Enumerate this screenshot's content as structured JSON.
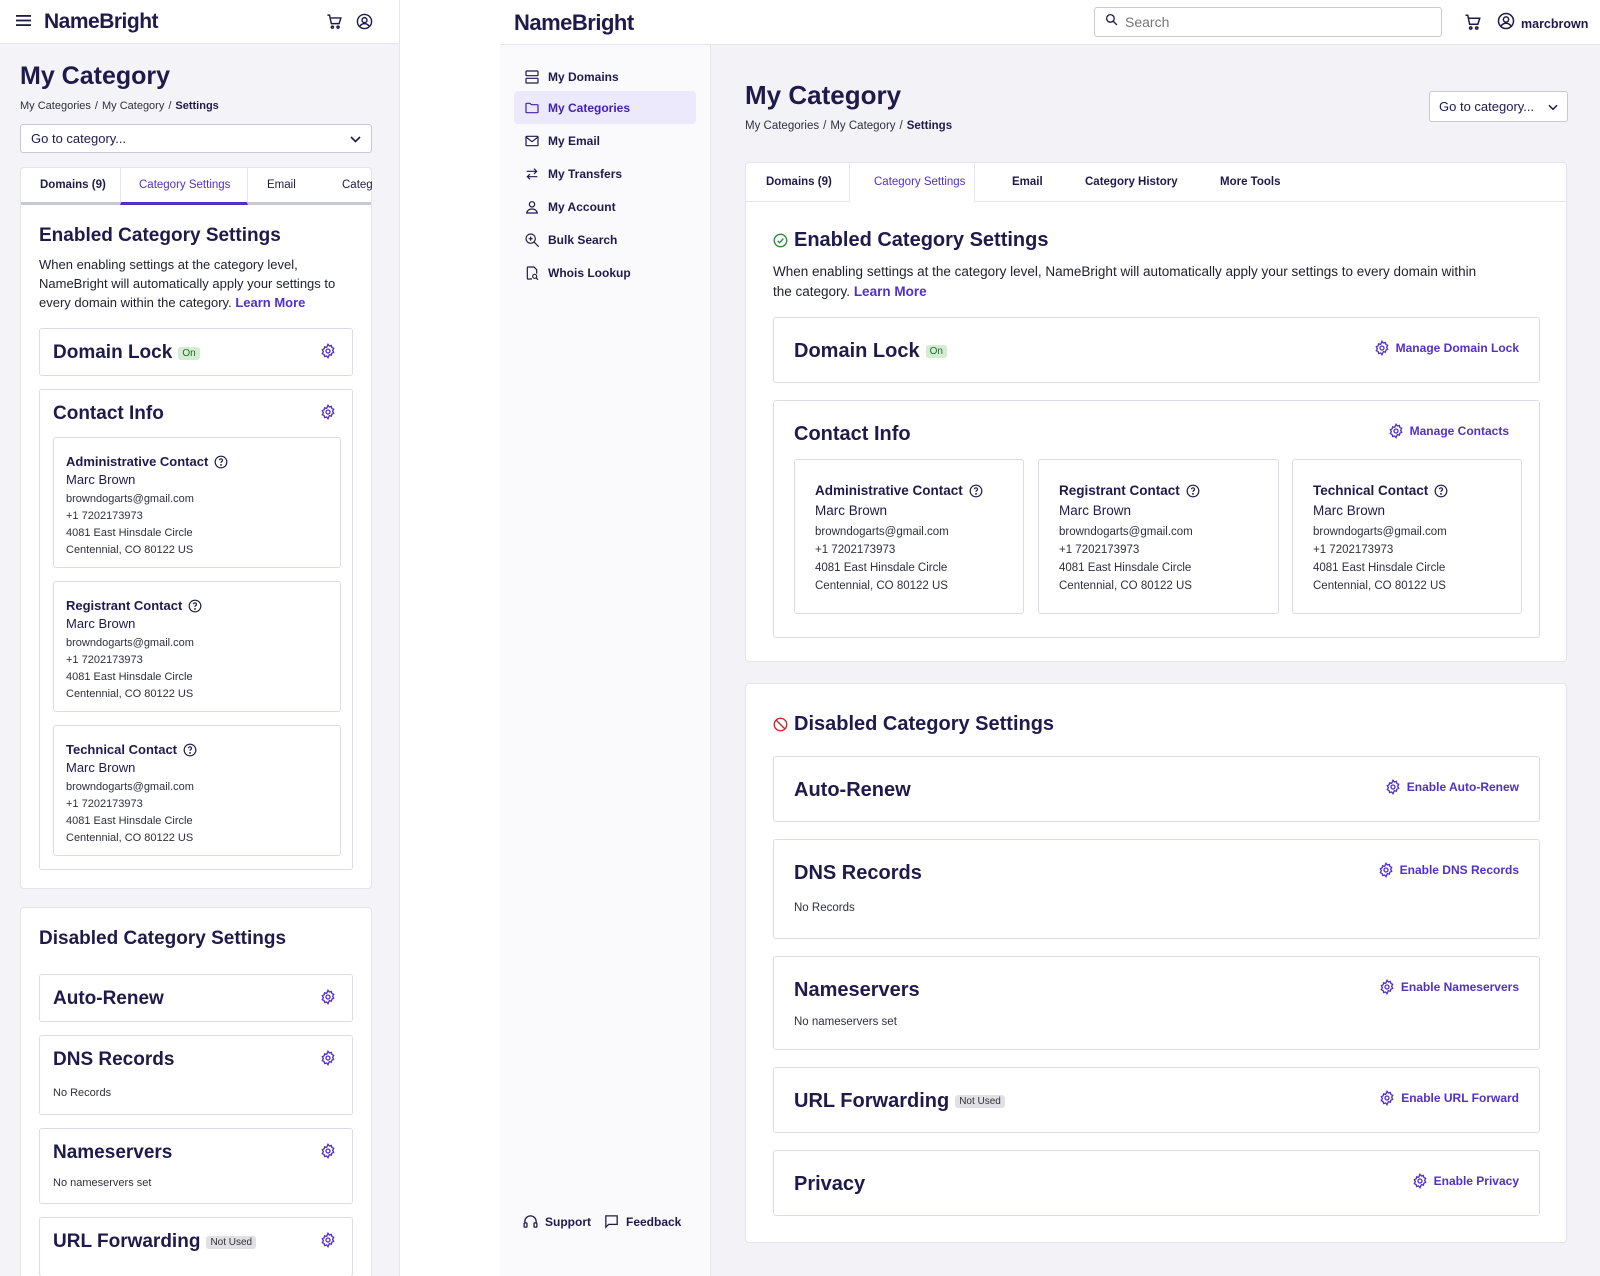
{
  "brand": "NameBright",
  "colors": {
    "accent": "#5230c7",
    "navy": "#1e1b4b",
    "on_badge": "#d4ecd3",
    "not_used_badge": "#e0e0e6",
    "check_green": "#2e8a3a",
    "disabled_red": "#c62828"
  },
  "header": {
    "search_placeholder": "Search",
    "username": "marcbrown"
  },
  "sidebar": {
    "items": [
      {
        "label": "My Domains",
        "icon": "server-icon"
      },
      {
        "label": "My Categories",
        "icon": "folder-icon"
      },
      {
        "label": "My Email",
        "icon": "mail-icon"
      },
      {
        "label": "My Transfers",
        "icon": "transfer-icon"
      },
      {
        "label": "My Account",
        "icon": "user-icon"
      },
      {
        "label": "Bulk Search",
        "icon": "search-plus-icon"
      },
      {
        "label": "Whois Lookup",
        "icon": "whois-icon"
      }
    ],
    "active_index": 1,
    "support": "Support",
    "feedback": "Feedback"
  },
  "page": {
    "title": "My Category",
    "breadcrumb": {
      "first": "My Categories",
      "second": "My Category",
      "current": "Settings",
      "sep": "/"
    },
    "go_to_category": "Go to category..."
  },
  "tabs": [
    "Domains (9)",
    "Category Settings",
    "Email",
    "Category History",
    "More Tools"
  ],
  "tabs_mobile_truncated": "Categ",
  "active_tab": 1,
  "enabled": {
    "title": "Enabled Category Settings",
    "desc": "When enabling settings at the category level, NameBright will automatically apply your settings to every domain within the category.",
    "desc_mobile_lines": [
      "When enabling settings at the category level,",
      "NameBright will automatically apply your settings to",
      "every domain within the category."
    ],
    "desc_line1": "When enabling settings at the category level, NameBright will automatically apply your settings to every domain within",
    "desc_line2": "the category.",
    "learn_more": "Learn More",
    "domain_lock": {
      "title": "Domain Lock",
      "badge": "On",
      "action": "Manage Domain Lock"
    },
    "contact_info": {
      "title": "Contact Info",
      "action": "Manage Contacts"
    },
    "contacts": [
      {
        "type": "Administrative Contact",
        "name": "Marc Brown",
        "email": "browndogarts@gmail.com",
        "phone": "+1 7202173973",
        "street": "4081 East Hinsdale Circle",
        "city": "Centennial, CO 80122 US"
      },
      {
        "type": "Registrant Contact",
        "name": "Marc Brown",
        "email": "browndogarts@gmail.com",
        "phone": "+1 7202173973",
        "street": "4081 East Hinsdale Circle",
        "city": "Centennial, CO 80122 US"
      },
      {
        "type": "Technical Contact",
        "name": "Marc Brown",
        "email": "browndogarts@gmail.com",
        "phone": "+1 7202173973",
        "street": "4081 East Hinsdale Circle",
        "city": "Centennial, CO 80122 US"
      }
    ]
  },
  "disabled": {
    "title": "Disabled Category Settings",
    "items": [
      {
        "title": "Auto-Renew",
        "action": "Enable Auto-Renew",
        "sub": "",
        "badge": ""
      },
      {
        "title": "DNS Records",
        "action": "Enable DNS Records",
        "sub": "No Records",
        "badge": ""
      },
      {
        "title": "Nameservers",
        "action": "Enable Nameservers",
        "sub": "No nameservers set",
        "badge": ""
      },
      {
        "title": "URL Forwarding",
        "action": "Enable URL Forward",
        "sub": "",
        "badge": "Not Used"
      },
      {
        "title": "Privacy",
        "action": "Enable Privacy",
        "sub": "",
        "badge": ""
      }
    ]
  }
}
